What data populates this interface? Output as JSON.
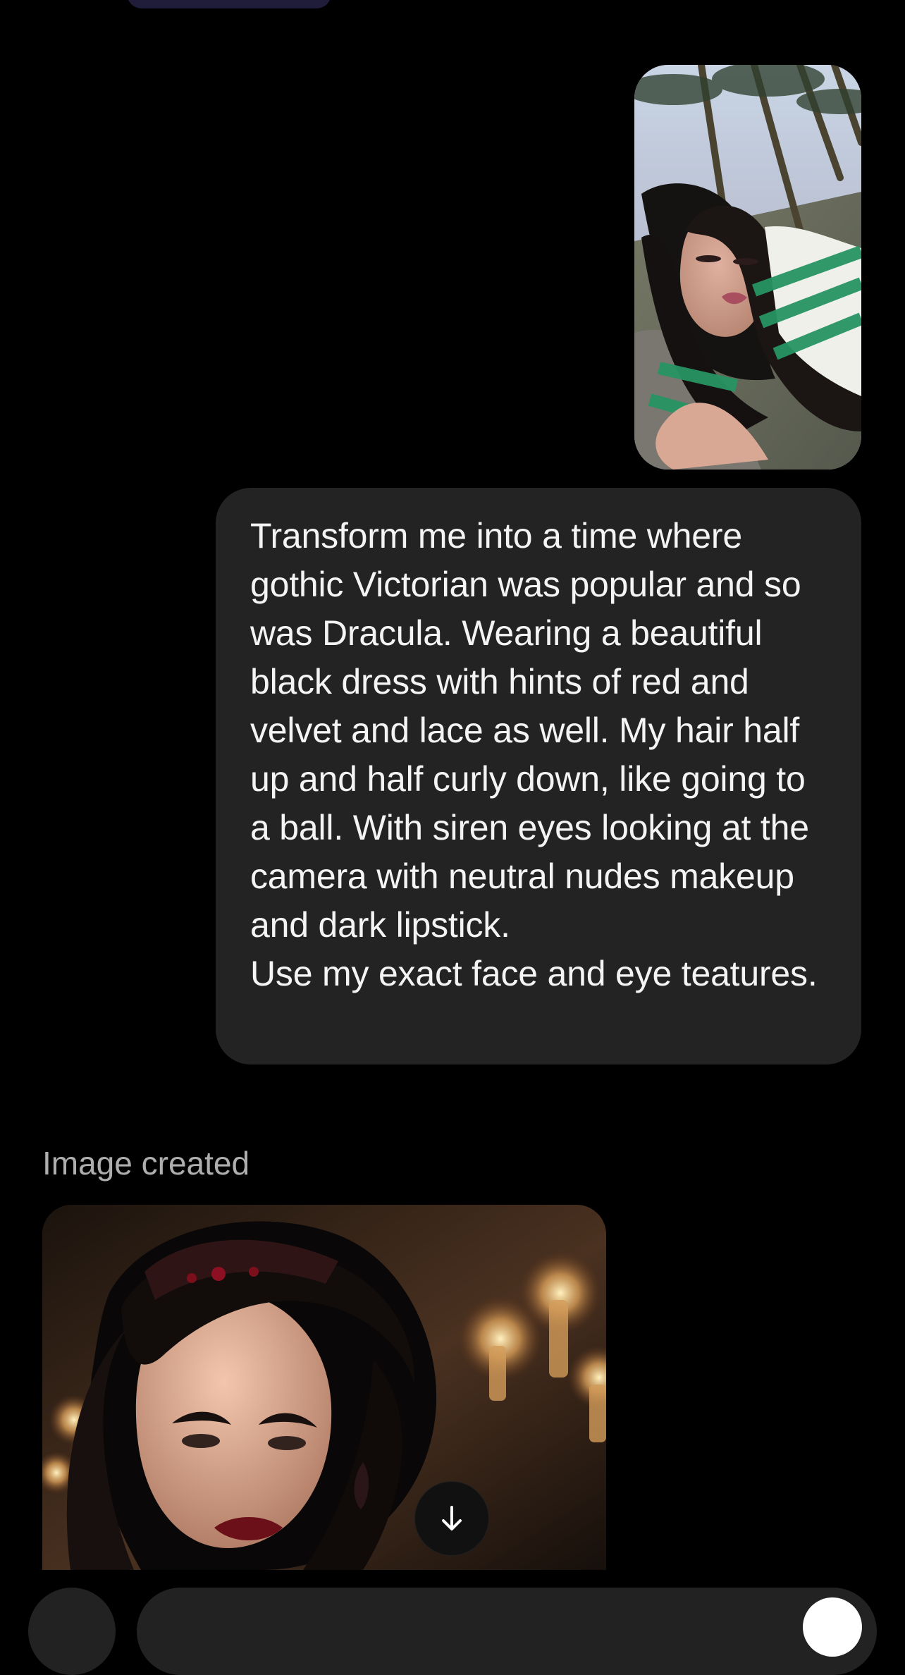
{
  "conversation": {
    "user_message": {
      "attachment_description_icon": "user-photo",
      "text": "Transform me into a time where gothic Victorian was popular and so was Dracula. Wearing a beautiful black dress with hints of red and velvet and lace as well. My hair half up and half curly down, like going to a ball. With siren eyes looking at the camera with neutral nudes makeup and dark lipstick.\nUse my exact face and eye teatures."
    },
    "assistant_message": {
      "status_label": "Image created",
      "image_icon": "generated-image"
    }
  },
  "controls": {
    "scroll_icon": "arrow-down-icon"
  },
  "colors": {
    "background": "#000000",
    "bubble": "#232323",
    "muted_text": "#aeaeae"
  }
}
